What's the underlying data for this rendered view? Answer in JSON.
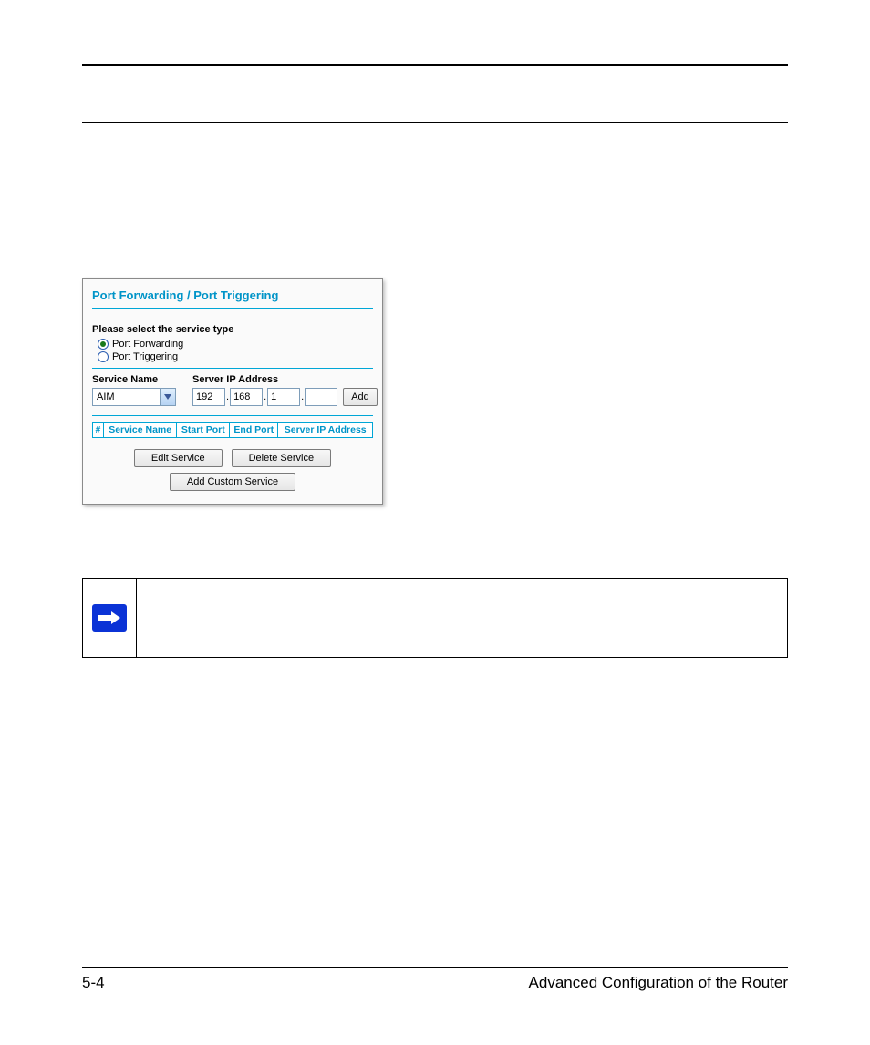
{
  "panel": {
    "title": "Port Forwarding / Port Triggering",
    "select_label": "Please select the service type",
    "radio_forwarding": "Port Forwarding",
    "radio_triggering": "Port Triggering",
    "service_name_label": "Service Name",
    "server_ip_label": "Server IP Address",
    "service_select_value": "AIM",
    "ip": {
      "o1": "192",
      "o2": "168",
      "o3": "1",
      "o4": ""
    },
    "add_label": "Add",
    "table": {
      "hash": "#",
      "service_name": "Service Name",
      "start_port": "Start Port",
      "end_port": "End Port",
      "server_ip": "Server IP Address"
    },
    "btn_edit": "Edit Service",
    "btn_delete": "Delete Service",
    "btn_add_custom": "Add Custom Service"
  },
  "footer": {
    "page": "5-4",
    "section": "Advanced Configuration of the Router"
  }
}
